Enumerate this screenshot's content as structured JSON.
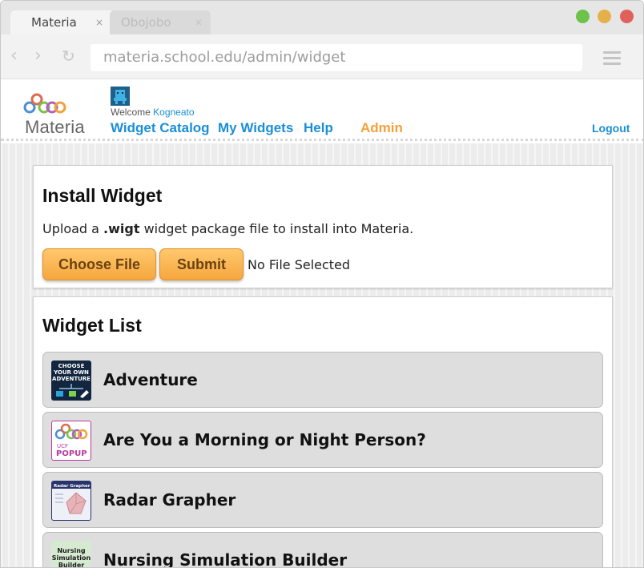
{
  "browser": {
    "tabs": [
      {
        "label": "Materia",
        "close": "×"
      },
      {
        "label": "Obojobo",
        "close": "×"
      }
    ],
    "url": "materia.school.edu/admin/widget"
  },
  "header": {
    "logo_text": "Materia",
    "welcome_prefix": "Welcome",
    "username": "Kogneato",
    "nav": {
      "catalog": "Widget Catalog",
      "my_widgets": "My Widgets",
      "help": "Help",
      "admin": "Admin",
      "logout": "Logout"
    }
  },
  "install": {
    "title": "Install Widget",
    "upload_prefix": "Upload a",
    "upload_ext": ".wigt",
    "upload_suffix": "widget package file to install into Materia.",
    "choose_label": "Choose File",
    "submit_label": "Submit",
    "file_status": "No File Selected"
  },
  "widget_list": {
    "title": "Widget List",
    "items": [
      {
        "name": "Adventure",
        "icon": "choose-your-own-adventure-icon",
        "icon_text": [
          "CHOOSE",
          "YOUR OWN",
          "ADVENTURE"
        ]
      },
      {
        "name": "Are You a Morning or Night Person?",
        "icon": "ucf-popup-icon",
        "icon_text": [
          "UCF",
          "POPUP"
        ]
      },
      {
        "name": "Radar Grapher",
        "icon": "radar-grapher-icon",
        "icon_text": [
          "Radar Grapher"
        ]
      },
      {
        "name": "Nursing Simulation Builder",
        "icon": "nursing-simulation-icon",
        "icon_text": [
          "Nursing",
          "Simulation",
          "Builder"
        ]
      }
    ]
  },
  "colors": {
    "link_blue": "#1a8ed6",
    "admin_orange": "#f4a13a",
    "button_orange": "#f6a640"
  }
}
